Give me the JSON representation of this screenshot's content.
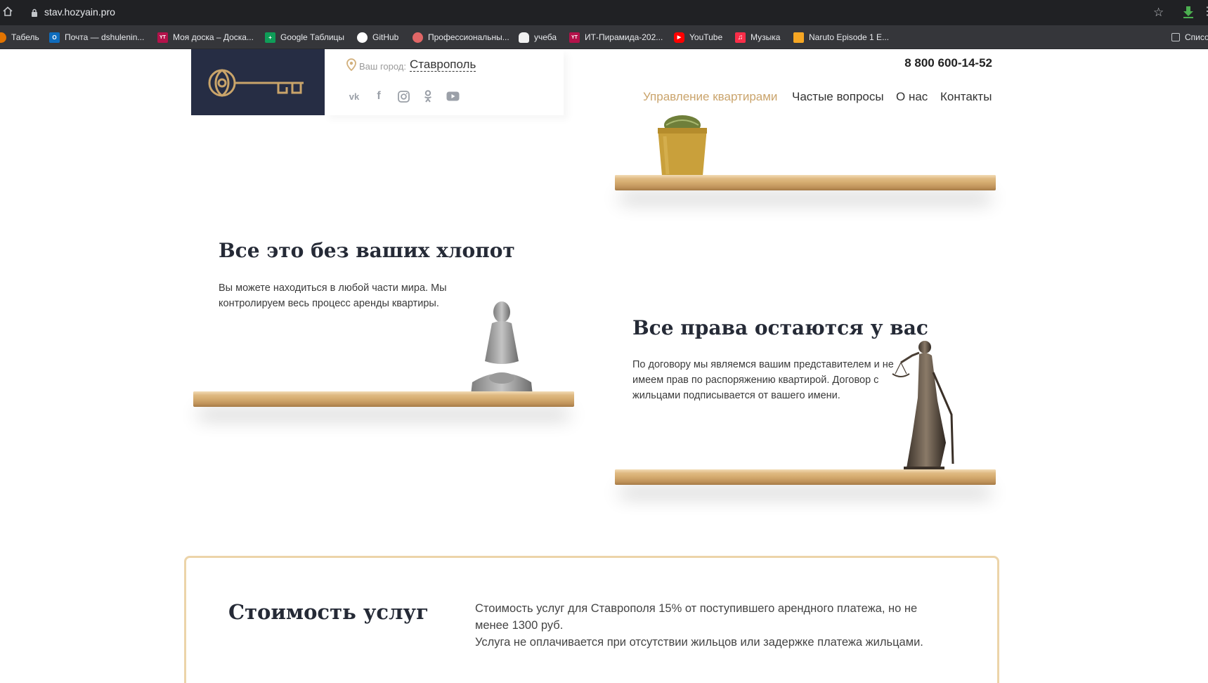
{
  "browser": {
    "url": "stav.hozyain.pro",
    "bookmarks": [
      {
        "label": "Табель",
        "color": "#e37400",
        "glyph": ""
      },
      {
        "label": "Почта — dshulenin...",
        "color": "#0f6cbd",
        "glyph": "O"
      },
      {
        "label": "Моя доска – Доска...",
        "color": "#b3124a",
        "glyph": "YT"
      },
      {
        "label": "Google Таблицы",
        "color": "#0f9d58",
        "glyph": "+"
      },
      {
        "label": "GitHub",
        "color": "#ffffff",
        "glyph": ""
      },
      {
        "label": "Профессиональны...",
        "color": "#e06666",
        "glyph": ""
      },
      {
        "label": "учеба",
        "color": "#f1f1f1",
        "glyph": ""
      },
      {
        "label": "ИТ-Пирамида-202...",
        "color": "#b3124a",
        "glyph": "YT"
      },
      {
        "label": "YouTube",
        "color": "#ff0000",
        "glyph": "▶"
      },
      {
        "label": "Музыка",
        "color": "#fa2d48",
        "glyph": "♫"
      },
      {
        "label": "Naruto Episode 1 E...",
        "color": "#f5a623",
        "glyph": ""
      },
      {
        "label": "Списо",
        "color": "#35363a",
        "glyph": ""
      }
    ]
  },
  "site": {
    "city_label": "Ваш город:",
    "city_name": "Ставрополь",
    "phone": "8 800 600-14-52",
    "nav": [
      "Управление квартирами",
      "Частые вопросы",
      "О нас",
      "Контакты"
    ],
    "socials": [
      "vk-icon",
      "facebook-icon",
      "instagram-icon",
      "odnoklassniki-icon",
      "youtube-icon"
    ],
    "accent_color": "#caa46c",
    "logo_bg": "#262d44"
  },
  "sections": {
    "no_hassle": {
      "title": "Все это без ваших хлопот",
      "text": "Вы можете находиться в любой части мира. Мы контролируем весь процесс аренды квартиры."
    },
    "rights": {
      "title": "Все права остаются у вас",
      "text": "По договору мы являемся вашим представителем и не имеем прав по распоряжению квартирой. Договор с жильцами подписывается от вашего имени."
    },
    "pricing": {
      "title": "Стоимость услуг",
      "line1": "Стоимость услуг для Ставрополя 15% от поступившего арендного платежа, но не менее 1300 руб.",
      "line2": "Услуга не оплачивается при отсутствии жильцов или задержке платежа жильцами."
    }
  }
}
